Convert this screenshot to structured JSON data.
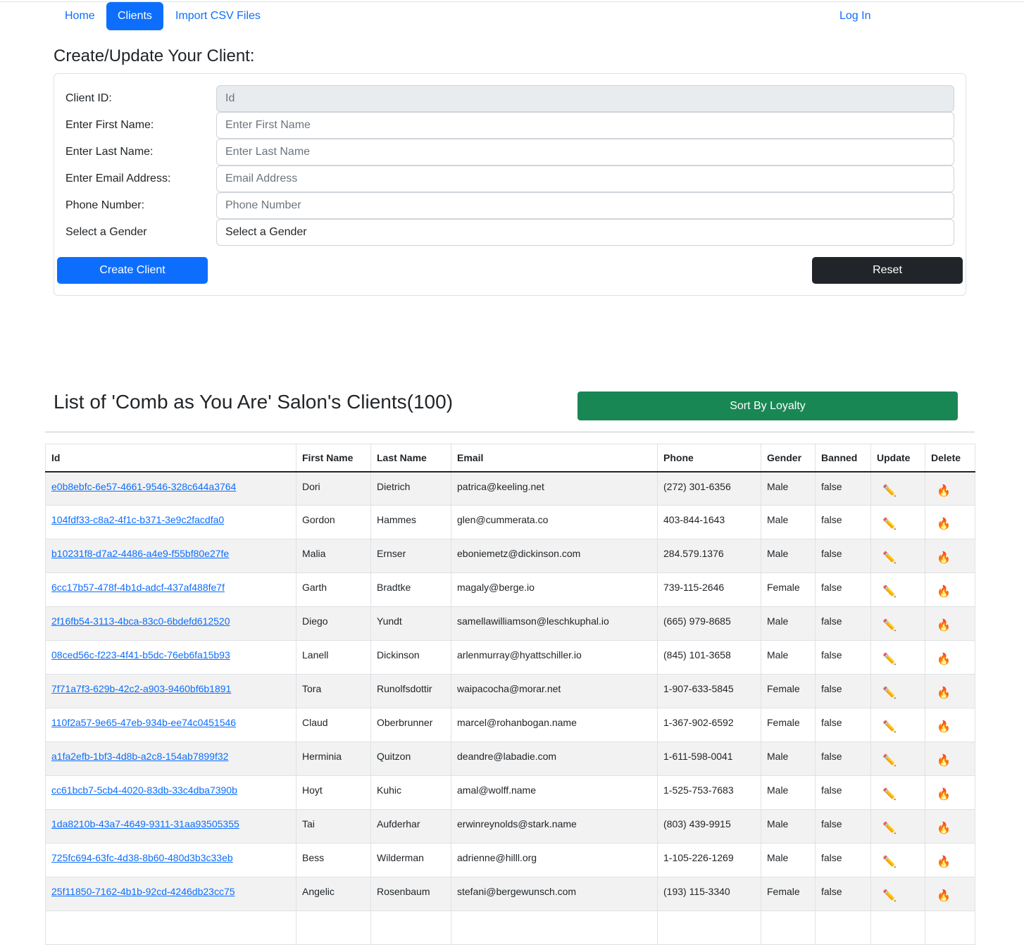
{
  "nav": {
    "home": "Home",
    "clients": "Clients",
    "import": "Import CSV Files",
    "login": "Log In"
  },
  "form": {
    "title": "Create/Update Your Client:",
    "id_label": "Client ID:",
    "id_placeholder": "Id",
    "first_label": "Enter First Name:",
    "first_placeholder": "Enter First Name",
    "last_label": "Enter Last Name:",
    "last_placeholder": "Enter Last Name",
    "email_label": "Enter Email Address:",
    "email_placeholder": "Email Address",
    "phone_label": "Phone Number:",
    "phone_placeholder": "Phone Number",
    "gender_label": "Select a Gender",
    "gender_value": "Select a Gender",
    "create_button": "Create  Client",
    "reset_button": "Reset"
  },
  "list": {
    "title": "List of 'Comb as You Are' Salon's Clients(100)",
    "sort_button": "Sort By Loyalty",
    "columns": [
      "Id",
      "First Name",
      "Last Name",
      "Email",
      "Phone",
      "Gender",
      "Banned",
      "Update",
      "Delete"
    ],
    "rows": [
      {
        "id": "e0b8ebfc-6e57-4661-9546-328c644a3764",
        "first": "Dori",
        "last": "Dietrich",
        "email": "patrica@keeling.net",
        "phone": "(272) 301-6356",
        "gender": "Male",
        "banned": "false"
      },
      {
        "id": "104fdf33-c8a2-4f1c-b371-3e9c2facdfa0",
        "first": "Gordon",
        "last": "Hammes",
        "email": "glen@cummerata.co",
        "phone": "403-844-1643",
        "gender": "Male",
        "banned": "false"
      },
      {
        "id": "b10231f8-d7a2-4486-a4e9-f55bf80e27fe",
        "first": "Malia",
        "last": "Ernser",
        "email": "eboniemetz@dickinson.com",
        "phone": "284.579.1376",
        "gender": "Male",
        "banned": "false"
      },
      {
        "id": "6cc17b57-478f-4b1d-adcf-437af488fe7f",
        "first": "Garth",
        "last": "Bradtke",
        "email": "magaly@berge.io",
        "phone": "739-115-2646",
        "gender": "Female",
        "banned": "false"
      },
      {
        "id": "2f16fb54-3113-4bca-83c0-6bdefd612520",
        "first": "Diego",
        "last": "Yundt",
        "email": "samellawilliamson@leschkuphal.io",
        "phone": "(665) 979-8685",
        "gender": "Male",
        "banned": "false"
      },
      {
        "id": "08ced56c-f223-4f41-b5dc-76eb6fa15b93",
        "first": "Lanell",
        "last": "Dickinson",
        "email": "arlenmurray@hyattschiller.io",
        "phone": "(845) 101-3658",
        "gender": "Male",
        "banned": "false"
      },
      {
        "id": "7f71a7f3-629b-42c2-a903-9460bf6b1891",
        "first": "Tora",
        "last": "Runolfsdottir",
        "email": "waipacocha@morar.net",
        "phone": "1-907-633-5845",
        "gender": "Female",
        "banned": "false"
      },
      {
        "id": "110f2a57-9e65-47eb-934b-ee74c0451546",
        "first": "Claud",
        "last": "Oberbrunner",
        "email": "marcel@rohanbogan.name",
        "phone": "1-367-902-6592",
        "gender": "Female",
        "banned": "false"
      },
      {
        "id": "a1fa2efb-1bf3-4d8b-a2c8-154ab7899f32",
        "first": "Herminia",
        "last": "Quitzon",
        "email": "deandre@labadie.com",
        "phone": "1-611-598-0041",
        "gender": "Male",
        "banned": "false"
      },
      {
        "id": "cc61bcb7-5cb4-4020-83db-33c4dba7390b",
        "first": "Hoyt",
        "last": "Kuhic",
        "email": "amal@wolff.name",
        "phone": "1-525-753-7683",
        "gender": "Male",
        "banned": "false"
      },
      {
        "id": "1da8210b-43a7-4649-9311-31aa93505355",
        "first": "Tai",
        "last": "Aufderhar",
        "email": "erwinreynolds@stark.name",
        "phone": "(803) 439-9915",
        "gender": "Male",
        "banned": "false"
      },
      {
        "id": "725fc694-63fc-4d38-8b60-480d3b3c33eb",
        "first": "Bess",
        "last": "Wilderman",
        "email": "adrienne@hilll.org",
        "phone": "1-105-226-1269",
        "gender": "Male",
        "banned": "false"
      },
      {
        "id": "25f11850-7162-4b1b-92cd-4246db23cc75",
        "first": "Angelic",
        "last": "Rosenbaum",
        "email": "stefani@bergewunsch.com",
        "phone": "(193) 115-3340",
        "gender": "Female",
        "banned": "false"
      },
      {
        "id": "",
        "first": "",
        "last": "",
        "email": "",
        "phone": "",
        "gender": "",
        "banned": ""
      }
    ],
    "update_icon": "✏️",
    "delete_icon": "🔥"
  }
}
